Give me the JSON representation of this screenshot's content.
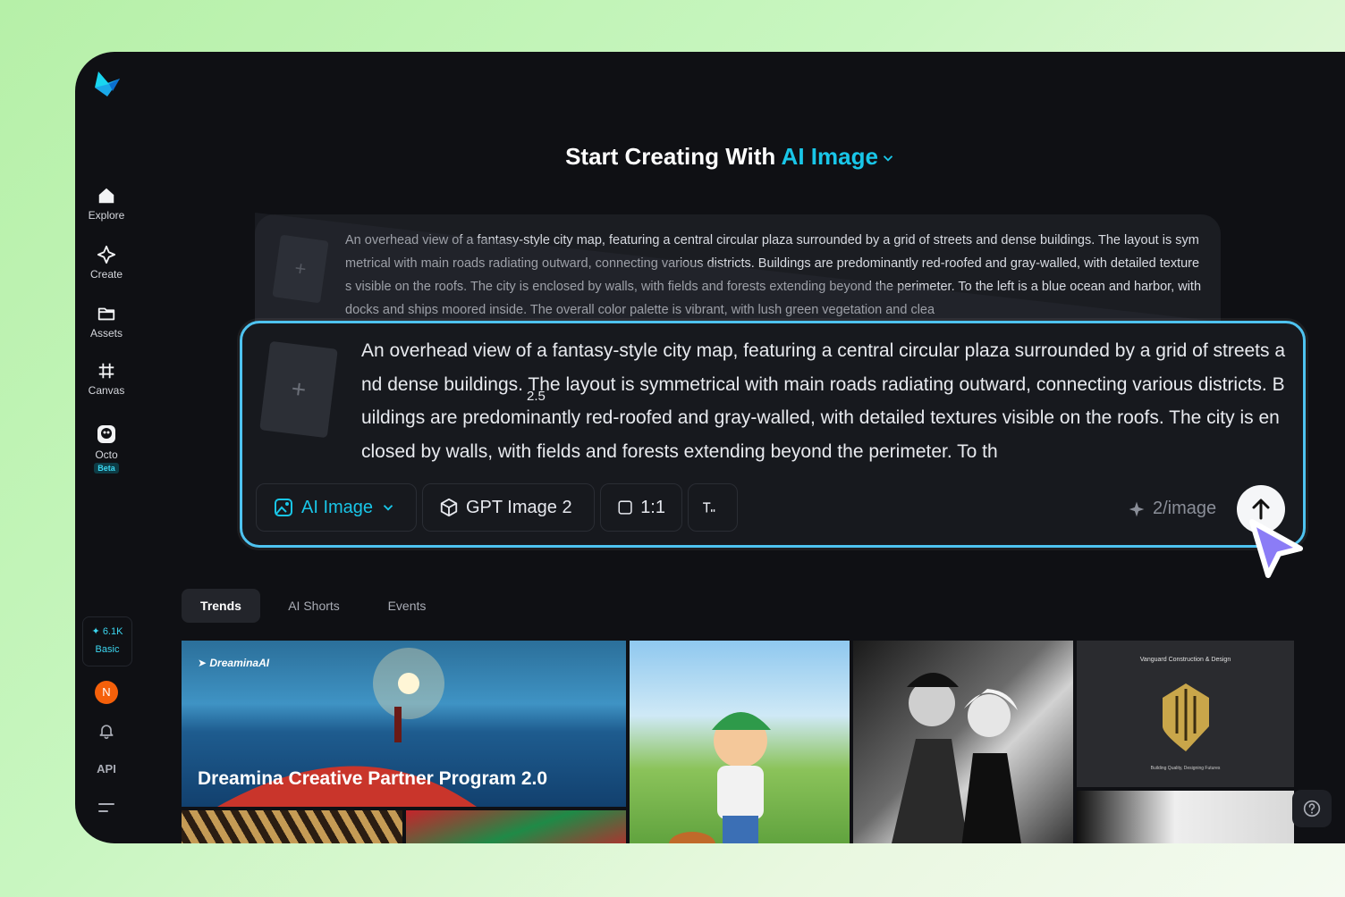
{
  "sidebar": {
    "items": [
      {
        "label": "Explore",
        "icon": "home-icon"
      },
      {
        "label": "Create",
        "icon": "sparkle-icon"
      },
      {
        "label": "Assets",
        "icon": "folder-icon"
      },
      {
        "label": "Canvas",
        "icon": "canvas-icon"
      },
      {
        "label": "Octo",
        "icon": "octo-icon",
        "badge": "Beta"
      }
    ],
    "credits": {
      "value": "6.1K",
      "plan": "Basic"
    },
    "avatar_initial": "N",
    "api_label": "API"
  },
  "headline": {
    "prefix": "Start Creating With ",
    "accent": "AI Image"
  },
  "ghost_prompt": "An overhead view of a fantasy-style city map, featuring a central circular plaza surrounded by a grid of streets and dense buildings. The layout is symmetrical with main roads radiating outward, connecting various districts. Buildings are predominantly red-roofed and gray-walled, with detailed textures visible on the roofs. The city is enclosed by walls, with fields and forests extending beyond the perimeter. To the left is a blue ocean and harbor, with docks and ships moored inside. The overall color palette is vibrant, with lush green vegetation and clea",
  "composer": {
    "prompt": "An overhead view of a fantasy-style city map, featuring a central circular plaza surrounded by a grid of streets and dense buildings. The layout is symmetrical with main roads radiating outward, connecting various districts. Buildings are predominantly red-roofed and gray-walled, with detailed textures visible on the roofs. The city is enclosed by walls, with fields and forests extending beyond the perimeter. To th",
    "scale_label": "2.5",
    "mode": "AI Image",
    "model": "GPT Image 2",
    "ratio": "1:1",
    "cost": "2/image"
  },
  "tabs": [
    "Trends",
    "AI Shorts",
    "Events"
  ],
  "gallery": {
    "featured_brand": "DreaminaAI",
    "featured_title": "Dreamina Creative Partner Program 2.0",
    "logo_card_title": "Vanguard Construction & Design",
    "logo_card_tagline": "Building Quality, Designing Futures"
  },
  "colors": {
    "accent": "#19c6e8",
    "composer_border": "#4ec3f0",
    "cursor": "#8b7cf6",
    "avatar": "#f5600a"
  }
}
